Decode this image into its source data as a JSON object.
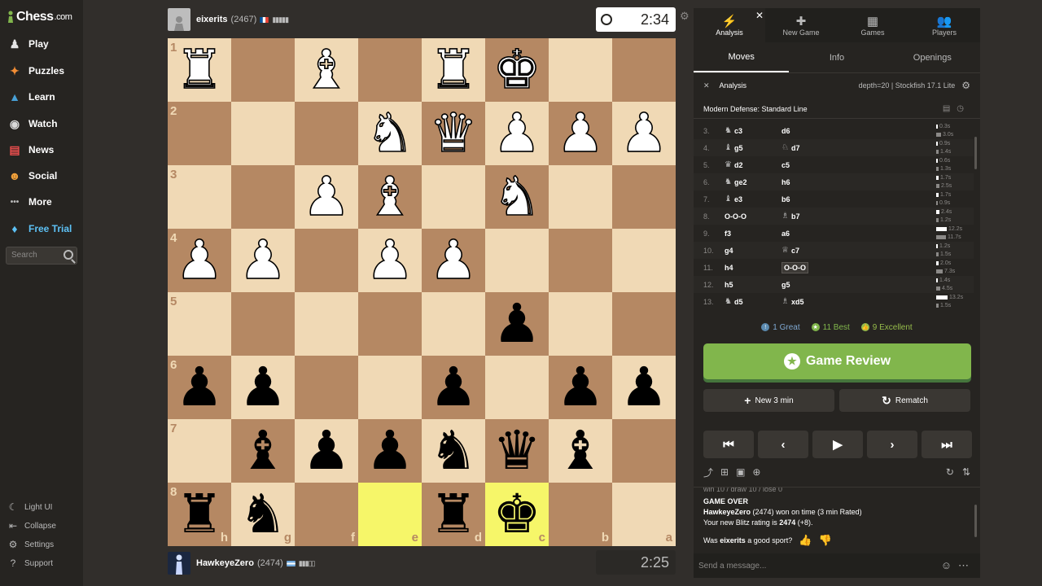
{
  "sidebar": {
    "logo": "Chess",
    "logo_suffix": ".com",
    "items": [
      {
        "label": "Play",
        "icon": "♟",
        "color": "#e5e5e5"
      },
      {
        "label": "Puzzles",
        "icon": "✦",
        "color": "#f28d35"
      },
      {
        "label": "Learn",
        "icon": "▲",
        "color": "#48a0d6"
      },
      {
        "label": "Watch",
        "icon": "◉",
        "color": "#d9d9d9"
      },
      {
        "label": "News",
        "icon": "▤",
        "color": "#e94d4d"
      },
      {
        "label": "Social",
        "icon": "☻",
        "color": "#f2a13a"
      },
      {
        "label": "More",
        "icon": "•••",
        "color": "#bababa"
      }
    ],
    "free_trial": "Free Trial",
    "search_placeholder": "Search",
    "bottom": [
      {
        "label": "Light UI",
        "icon": "☾"
      },
      {
        "label": "Collapse",
        "icon": "⇤"
      },
      {
        "label": "Settings",
        "icon": "⚙"
      },
      {
        "label": "Support",
        "icon": "?"
      }
    ]
  },
  "top_player": {
    "name": "eixerits",
    "rating": "(2467)",
    "bars": "▮▮▮▮▮",
    "clock": "2:34"
  },
  "bottom_player": {
    "name": "HawkeyeZero",
    "rating": "(2474)",
    "bars": "▮▮▮▯▯",
    "clock": "2:25"
  },
  "board": {
    "rank_labels": [
      "1",
      "2",
      "3",
      "4",
      "5",
      "6",
      "7",
      "8"
    ],
    "file_labels": [
      "h",
      "g",
      "f",
      "e",
      "d",
      "c",
      "b",
      "a"
    ],
    "rows": [
      [
        "wR",
        "",
        "wB",
        "",
        "wR",
        "wK",
        "",
        ""
      ],
      [
        "",
        "",
        "",
        "wN",
        "wQ",
        "wP",
        "wP",
        "wP"
      ],
      [
        "",
        "",
        "wP",
        "wB",
        "",
        "wN",
        "",
        ""
      ],
      [
        "wP",
        "wP",
        "",
        "wP",
        "wP",
        "",
        "",
        ""
      ],
      [
        "",
        "",
        "",
        "",
        "",
        "bP",
        "",
        ""
      ],
      [
        "bP",
        "bP",
        "",
        "",
        "bP",
        "",
        "bP",
        "bP"
      ],
      [
        "",
        "bB",
        "bP",
        "bP",
        "bN",
        "bQ",
        "bB",
        ""
      ],
      [
        "bR",
        "bN",
        "",
        "",
        "bR",
        "bK",
        "",
        ""
      ]
    ],
    "highlight": [
      [
        7,
        3
      ],
      [
        7,
        5
      ]
    ]
  },
  "panel": {
    "tabs": [
      {
        "label": "Analysis",
        "icon": "⚡"
      },
      {
        "label": "New Game",
        "icon": "✚"
      },
      {
        "label": "Games",
        "icon": "▦"
      },
      {
        "label": "Players",
        "icon": "👥"
      }
    ],
    "close": "✕",
    "subtabs": [
      "Moves",
      "Info",
      "Openings"
    ],
    "analysis_label": "Analysis",
    "engine": "depth=20  |  Stockfish 17.1 Lite",
    "opening": "Modern Defense: Standard Line",
    "moves": [
      {
        "n": "3.",
        "wp": "♞",
        "w": "c3",
        "bp": "",
        "b": "d6",
        "t1": "0.3s",
        "t2": "3.0s",
        "b1": 2,
        "b2": 6
      },
      {
        "n": "4.",
        "wp": "♝",
        "w": "g5",
        "bp": "♘",
        "b": "d7",
        "t1": "0.9s",
        "t2": "1.4s",
        "b1": 2,
        "b2": 3
      },
      {
        "n": "5.",
        "wp": "♛",
        "w": "d2",
        "bp": "",
        "b": "c5",
        "t1": "0.6s",
        "t2": "1.3s",
        "b1": 2,
        "b2": 3
      },
      {
        "n": "6.",
        "wp": "♞",
        "w": "ge2",
        "bp": "",
        "b": "h6",
        "t1": "1.7s",
        "t2": "2.5s",
        "b1": 3,
        "b2": 4
      },
      {
        "n": "7.",
        "wp": "♝",
        "w": "e3",
        "bp": "",
        "b": "b6",
        "t1": "1.7s",
        "t2": "0.9s",
        "b1": 3,
        "b2": 2
      },
      {
        "n": "8.",
        "wp": "",
        "w": "O-O-O",
        "bp": "♗",
        "b": "b7",
        "t1": "2.4s",
        "t2": "1.2s",
        "b1": 4,
        "b2": 3
      },
      {
        "n": "9.",
        "wp": "",
        "w": "f3",
        "bp": "",
        "b": "a6",
        "t1": "12.2s",
        "t2": "11.7s",
        "b1": 13,
        "b2": 12
      },
      {
        "n": "10.",
        "wp": "",
        "w": "g4",
        "bp": "♕",
        "b": "c7",
        "t1": "1.2s",
        "t2": "1.5s",
        "b1": 2,
        "b2": 3
      },
      {
        "n": "11.",
        "wp": "",
        "w": "h4",
        "bp": "",
        "b": "O-O-O",
        "t1": "2.0s",
        "t2": "7.3s",
        "b1": 3,
        "b2": 8
      },
      {
        "n": "12.",
        "wp": "",
        "w": "h5",
        "bp": "",
        "b": "g5",
        "t1": "1.4s",
        "t2": "4.5s",
        "b1": 2,
        "b2": 5
      },
      {
        "n": "13.",
        "wp": "♞",
        "w": "d5",
        "bp": "♗",
        "b": "xd5",
        "t1": "13.2s",
        "t2": "1.5s",
        "b1": 14,
        "b2": 3
      }
    ],
    "classif": [
      {
        "label": "1 Great",
        "color": "#5c8bb0",
        "glyph": "!",
        "text_color": "#7fa8d1"
      },
      {
        "label": "11 Best",
        "color": "#81b64c",
        "glyph": "★",
        "text_color": "#81b64c"
      },
      {
        "label": "9 Excellent",
        "color": "#96bc4b",
        "glyph": "👍",
        "text_color": "#96bc4b"
      }
    ],
    "review_button": "Game Review",
    "new_game": "New 3 min",
    "rematch": "Rematch",
    "nav": [
      "⏮",
      "‹",
      "▶",
      "›",
      "⏭"
    ],
    "chat_cut": "win 10 / draw 10 / lose 0",
    "game_over": "GAME OVER",
    "result_name": "HawkeyeZero",
    "result_text": "(2474) won on time (3 min Rated)",
    "rating_prefix": "Your new Blitz rating is",
    "rating_value": "2474",
    "rating_suffix": "(+8).",
    "sport_prefix": "Was",
    "sport_name": "eixerits",
    "sport_suffix": "a good sport?",
    "chat_placeholder": "Send a message..."
  }
}
